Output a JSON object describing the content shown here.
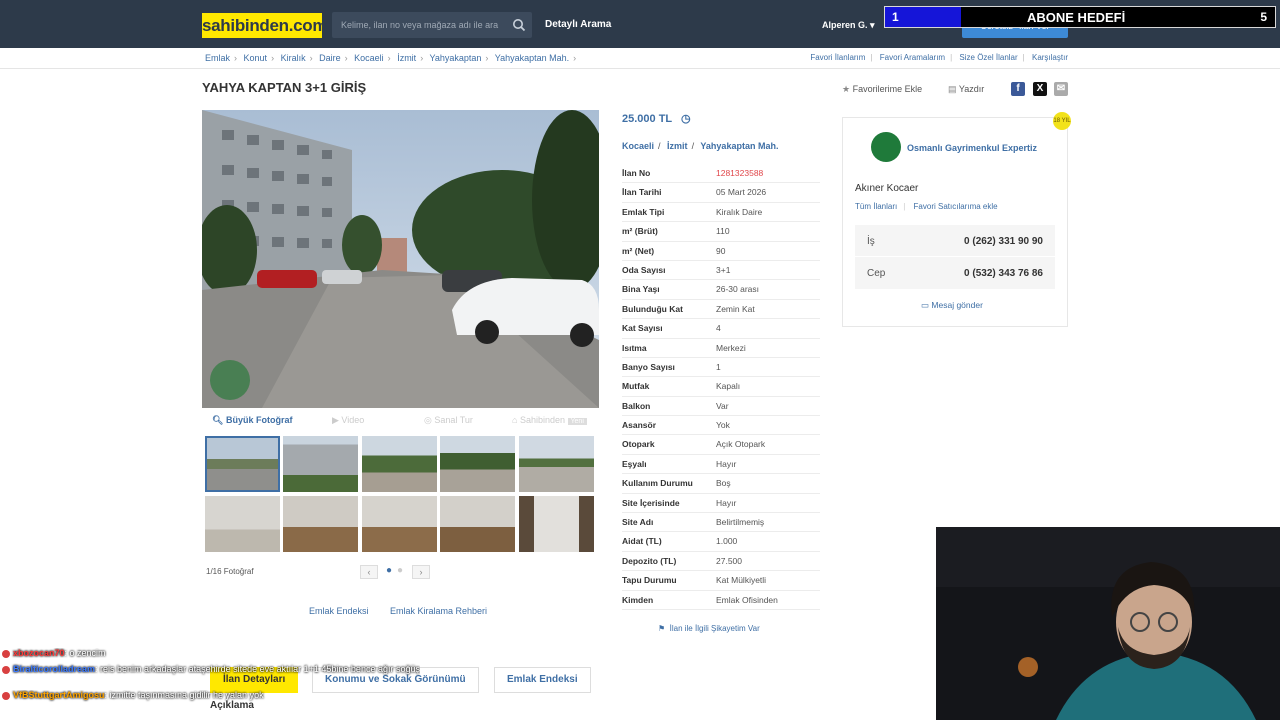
{
  "header": {
    "logo": "sahibinden.com",
    "search_placeholder": "Kelime, ilan no veya mağaza adı ile ara",
    "advanced_search": "Detaylı Arama",
    "user": "Alperen G. ▾",
    "free_ad": "Ücretsiz* İlan Ver"
  },
  "sub_goal": {
    "current": "1",
    "title": "ABONE HEDEFİ",
    "goal": "5",
    "progress": 0.2
  },
  "breadcrumb": [
    "Emlak",
    "Konut",
    "Kiralık",
    "Daire",
    "Kocaeli",
    "İzmit",
    "Yahyakaptan",
    "Yahyakaptan Mah."
  ],
  "quicklinks": [
    "Favori İlanlarım",
    "Favori Aramalarım",
    "Size Özel İlanlar",
    "Karşılaştır"
  ],
  "listing": {
    "title": "YAHYA KAPTAN 3+1 GİRİŞ",
    "add_favorite": "Favorilerime Ekle",
    "print": "Yazdır",
    "price": "25.000 TL",
    "location": [
      "Kocaeli",
      "İzmit",
      "Yahyakaptan Mah."
    ]
  },
  "media": {
    "big_photo": "Büyük Fotoğraf",
    "video": "Video",
    "virtual_tour": "Sanal Tur",
    "own_house": "Sahibinden",
    "own_badge": "Yeni",
    "counter": "1/16 Fotoğraf"
  },
  "below_links": [
    "Emlak Endeksi",
    "Emlak Kiralama Rehberi"
  ],
  "details": [
    {
      "k": "İlan No",
      "v": "1281323588"
    },
    {
      "k": "İlan Tarihi",
      "v": "05 Mart 2026"
    },
    {
      "k": "Emlak Tipi",
      "v": "Kiralık Daire"
    },
    {
      "k": "m² (Brüt)",
      "v": "110"
    },
    {
      "k": "m² (Net)",
      "v": "90"
    },
    {
      "k": "Oda Sayısı",
      "v": "3+1"
    },
    {
      "k": "Bina Yaşı",
      "v": "26-30 arası"
    },
    {
      "k": "Bulunduğu Kat",
      "v": "Zemin Kat"
    },
    {
      "k": "Kat Sayısı",
      "v": "4"
    },
    {
      "k": "Isıtma",
      "v": "Merkezi"
    },
    {
      "k": "Banyo Sayısı",
      "v": "1"
    },
    {
      "k": "Mutfak",
      "v": "Kapalı"
    },
    {
      "k": "Balkon",
      "v": "Var"
    },
    {
      "k": "Asansör",
      "v": "Yok"
    },
    {
      "k": "Otopark",
      "v": "Açık Otopark"
    },
    {
      "k": "Eşyalı",
      "v": "Hayır"
    },
    {
      "k": "Kullanım Durumu",
      "v": "Boş"
    },
    {
      "k": "Site İçerisinde",
      "v": "Hayır"
    },
    {
      "k": "Site Adı",
      "v": "Belirtilmemiş"
    },
    {
      "k": "Aidat (TL)",
      "v": "1.000"
    },
    {
      "k": "Depozito (TL)",
      "v": "27.500"
    },
    {
      "k": "Tapu Durumu",
      "v": "Kat Mülkiyetli"
    },
    {
      "k": "Kimden",
      "v": "Emlak Ofisinden"
    }
  ],
  "complaint": "İlan ile İlgili Şikayetim Var",
  "seller": {
    "office": "Osmanlı Gayrimenkul Expertiz",
    "badge": "18 YIL",
    "person": "Akıner Kocaer",
    "all_ads": "Tüm İlanları",
    "add_fav_seller": "Favori Satıcılarıma ekle",
    "work_label": "İş",
    "work_phone": "0 (262) 331 90 90",
    "mobile_label": "Cep",
    "mobile_phone": "0 (532) 343 76 86",
    "message": "Mesaj gönder"
  },
  "tabs": [
    "İlan Detayları",
    "Konumu ve Sokak Görünümü",
    "Emlak Endeksi"
  ],
  "section_title": "Açıklama",
  "chat": [
    {
      "user": "xbozocan70",
      "msg": ": o zencim"
    },
    {
      "user": "Biralticorolladream",
      "msg": ": reis benim arkadaşlar ataşehirde sitede eve aktılar 1+1 45bine bence ağır soğüş"
    },
    {
      "user": "VfBStuttgartAmigosu",
      "msg": ": izmitte taşınmasına gidilir he yalan yok"
    }
  ],
  "colors": {
    "header_bg": "#2d3a4a",
    "logo_yellow": "#ffe800",
    "link_blue": "#3f6fa5",
    "listing_no_red": "#e0464a"
  }
}
